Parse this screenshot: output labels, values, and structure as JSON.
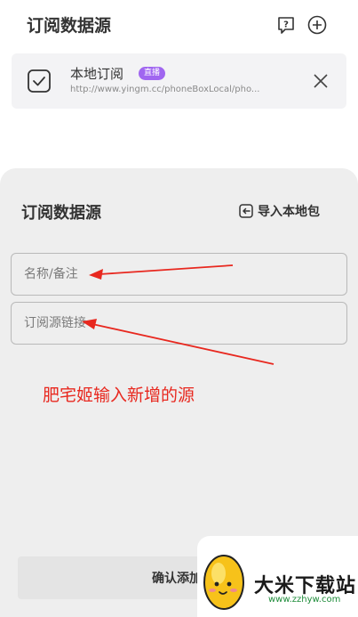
{
  "header": {
    "title": "订阅数据源",
    "help_icon": "question-bubble-icon",
    "add_icon": "plus-circle-icon"
  },
  "subscriptions": [
    {
      "name": "本地订阅",
      "badge": "直播",
      "url": "http://www.yingm.cc/phoneBoxLocal/pho...",
      "checked": true
    }
  ],
  "dialog": {
    "title": "订阅数据源",
    "import_label": "导入本地包",
    "name_placeholder": "名称/备注",
    "url_placeholder": "订阅源链接",
    "confirm_label": "确认添加"
  },
  "annotation": {
    "text": "肥宅姬输入新增的源",
    "color": "#e8281f"
  },
  "watermark": {
    "name": "大米下载站",
    "url": "www.zzhyw.com"
  },
  "colors": {
    "badge": "#a066f0",
    "dialog_bg": "#eeeeee",
    "card_bg": "#f3f3f5"
  }
}
